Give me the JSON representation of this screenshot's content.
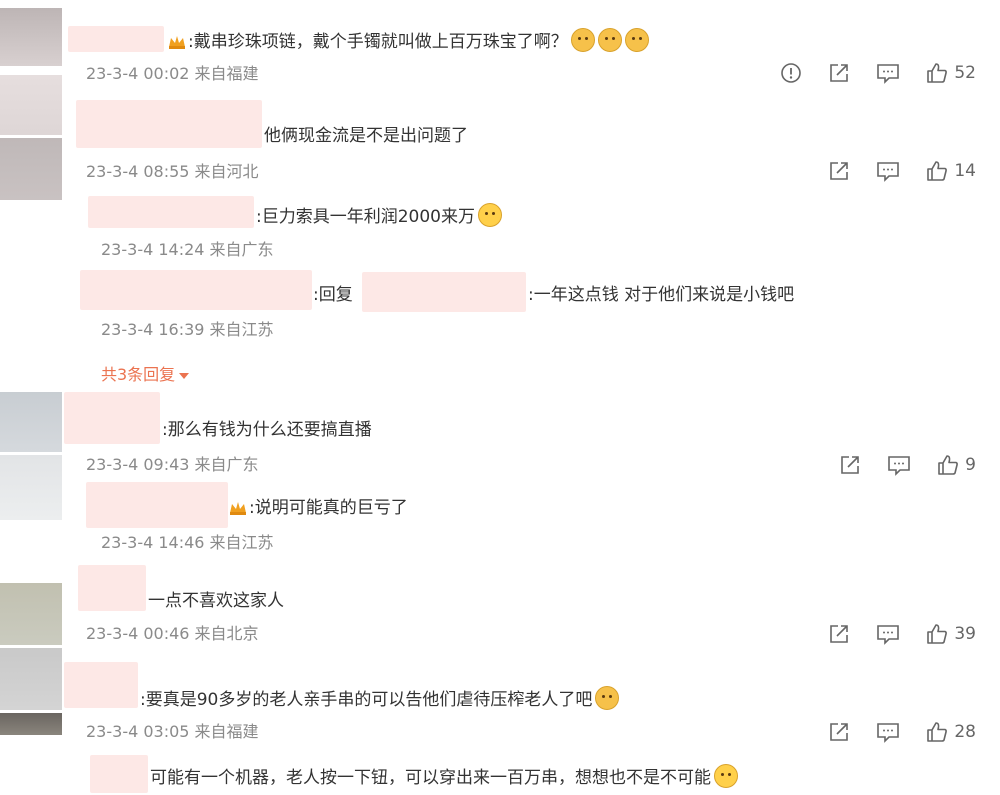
{
  "comments": [
    {
      "text": ":戴串珍珠项链，戴个手镯就叫做上百万珠宝了啊？",
      "meta": "23-3-4 00:02 来自福建",
      "likes": "52"
    },
    {
      "text": "他俩现金流是不是出问题了",
      "meta": "23-3-4 08:55 来自河北",
      "likes": "14"
    },
    {
      "text": ":巨力索具一年利润2000来万",
      "meta": "23-3-4 14:24 来自广东"
    },
    {
      "text_prefix": ":回复",
      "text_suffix": ":一年这点钱 对于他们来说是小钱吧",
      "meta": "23-3-4 16:39 来自江苏"
    },
    {
      "more": "共3条回复"
    },
    {
      "text": ":那么有钱为什么还要搞直播",
      "meta": "23-3-4 09:43 来自广东",
      "likes": "9"
    },
    {
      "text": ":说明可能真的巨亏了",
      "meta": "23-3-4 14:46 来自江苏"
    },
    {
      "text": "一点不喜欢这家人",
      "meta": "23-3-4 00:46 来自北京",
      "likes": "39"
    },
    {
      "text": ":要真是90多岁的老人亲手串的可以告他们虐待压榨老人了吧",
      "meta": "23-3-4 03:05 来自福建",
      "likes": "28"
    },
    {
      "text": "可能有一个机器，老人按一下钮，可以穿出来一百万串，想想也不是不可能"
    }
  ],
  "icons": [
    "report-icon",
    "share-icon",
    "comment-icon",
    "like-icon",
    "crown-icon",
    "emoji-icon"
  ],
  "colors": {
    "more_link": "#eb7350",
    "meta": "#8a8a8a",
    "redaction": "#fde8e6"
  }
}
